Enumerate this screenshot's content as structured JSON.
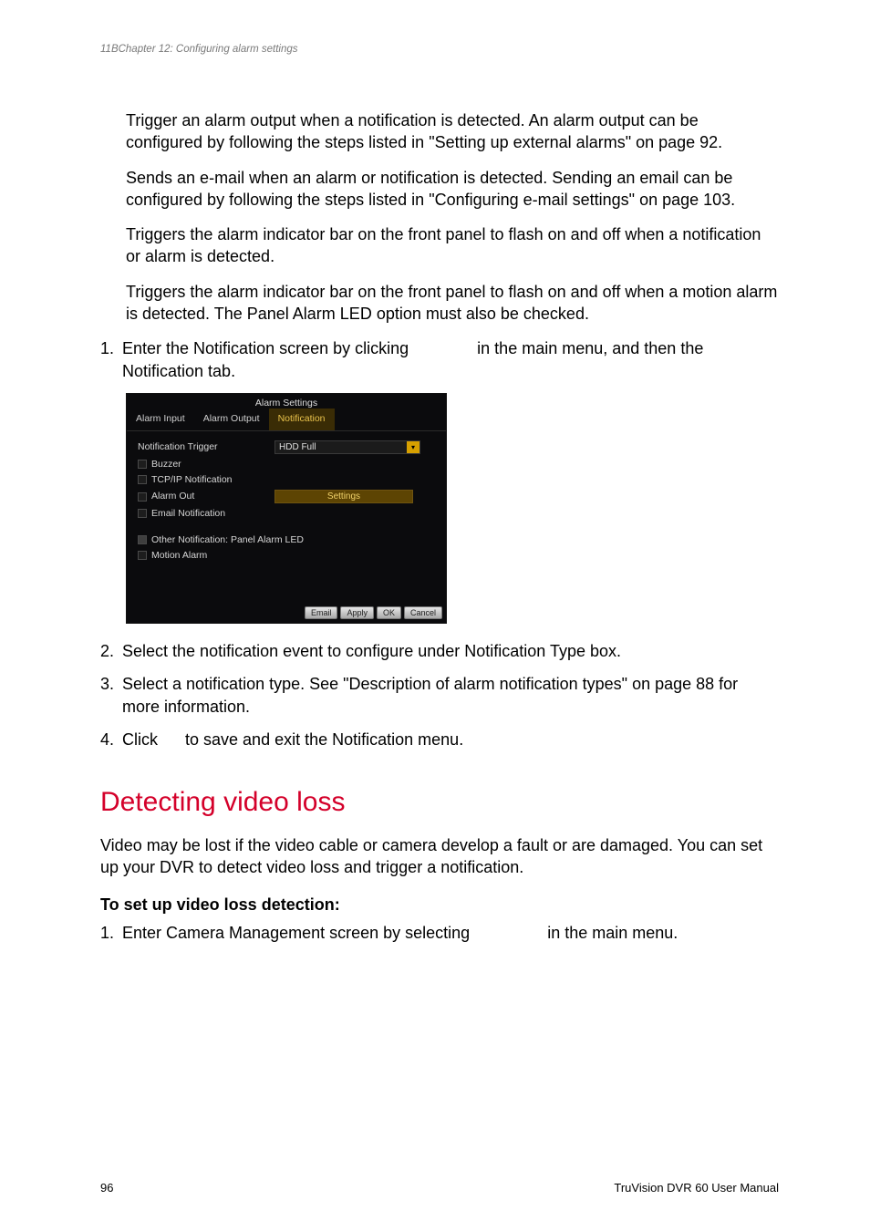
{
  "running_head": "11BChapter 12: Configuring alarm settings",
  "paras": {
    "alarm_out": "Trigger an alarm output when a notification is detected. An alarm output can be configured by following the steps listed in \"Setting up external alarms\" on page 92.",
    "email": "Sends an e-mail when an alarm or notification is detected. Sending an email can be configured by following the steps listed in \"Configuring e-mail settings\" on page 103.",
    "panel_led": "Triggers the alarm indicator bar on the front panel to flash on and off when a notification or alarm is detected.",
    "motion_alarm": "Triggers the alarm indicator bar on the front panel to flash on and off when a motion alarm is detected. The Panel Alarm LED option must also be checked."
  },
  "steps_a": {
    "s1a": "Enter the Notification screen by clicking",
    "s1b": "in the main menu, and then the Notification tab.",
    "s2": "Select the notification event to configure under Notification Type box.",
    "s3": "Select a notification type. See \"Description of alarm notification types\" on page 88 for more information.",
    "s4a": "Click",
    "s4b": "to save and exit the Notification menu."
  },
  "shot": {
    "title": "Alarm Settings",
    "tabs": {
      "t1": "Alarm Input",
      "t2": "Alarm Output",
      "t3": "Notification"
    },
    "labels": {
      "trigger": "Notification Trigger",
      "buzzer": "Buzzer",
      "tcpip": "TCP/IP Notification",
      "alarm_out": "Alarm Out",
      "email": "Email Notification",
      "other": "Other Notification: Panel Alarm LED",
      "motion": "Motion Alarm"
    },
    "dropdown": "HDD Full",
    "settings_btn": "Settings",
    "buttons": {
      "email": "Email",
      "apply": "Apply",
      "ok": "OK",
      "cancel": "Cancel"
    }
  },
  "section": {
    "h2": "Detecting video loss",
    "p": "Video may be lost if the video cable or camera develop a fault or are damaged. You can set up your DVR to detect video loss and trigger a notification.",
    "h3": "To set up video loss detection:",
    "s1a": "Enter Camera Management screen by selecting",
    "s1b": "in the main menu."
  },
  "footer": {
    "page": "96",
    "manual": "TruVision DVR 60 User Manual"
  }
}
